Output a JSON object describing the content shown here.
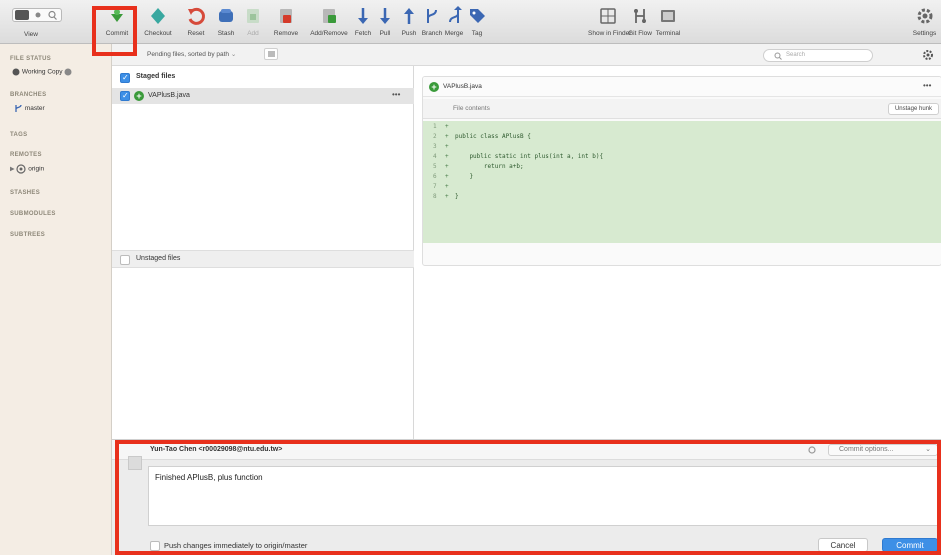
{
  "toolbar": {
    "view_label": "View",
    "buttons": [
      {
        "label": "Commit",
        "icon": "commit-icon"
      },
      {
        "label": "Checkout",
        "icon": "checkout-icon"
      },
      {
        "label": "Reset",
        "icon": "reset-icon"
      },
      {
        "label": "Stash",
        "icon": "stash-icon"
      },
      {
        "label": "Add",
        "icon": "add-icon"
      },
      {
        "label": "Remove",
        "icon": "remove-icon"
      },
      {
        "label": "Add/Remove",
        "icon": "add-remove-icon"
      },
      {
        "label": "Fetch",
        "icon": "fetch-icon"
      },
      {
        "label": "Pull",
        "icon": "pull-icon"
      },
      {
        "label": "Push",
        "icon": "push-icon"
      },
      {
        "label": "Branch",
        "icon": "branch-icon"
      },
      {
        "label": "Merge",
        "icon": "merge-icon"
      },
      {
        "label": "Tag",
        "icon": "tag-icon"
      },
      {
        "label": "Show in Finder",
        "icon": "finder-icon"
      },
      {
        "label": "Git Flow",
        "icon": "git-flow-icon"
      },
      {
        "label": "Terminal",
        "icon": "terminal-icon"
      },
      {
        "label": "Settings",
        "icon": "gear-icon"
      }
    ]
  },
  "sidebar": {
    "file_status_header": "FILE STATUS",
    "working_copy": "Working Copy",
    "branches_header": "BRANCHES",
    "branch_master": "master",
    "tags_header": "TAGS",
    "remotes_header": "REMOTES",
    "remote_origin": "origin",
    "stashes_header": "STASHES",
    "submodules_header": "SUBMODULES",
    "subtrees_header": "SUBTREES"
  },
  "files": {
    "sort_label": "Pending files, sorted by path",
    "staged_header": "Staged files",
    "staged_files": [
      {
        "name": "VAPlusB.java"
      }
    ],
    "unstaged_header": "Unstaged files",
    "row_menu": "•••"
  },
  "diff": {
    "search_placeholder": "Search",
    "file_name": "VAPlusB.java",
    "file_menu": "•••",
    "hunk_title": "File contents",
    "unstage_hunk_label": "Unstage hunk",
    "lines": [
      {
        "num": "1",
        "sign": "+",
        "text": ""
      },
      {
        "num": "2",
        "sign": "+",
        "text": "public class APlusB {"
      },
      {
        "num": "3",
        "sign": "+",
        "text": ""
      },
      {
        "num": "4",
        "sign": "+",
        "text": "    public static int plus(int a, int b){"
      },
      {
        "num": "5",
        "sign": "+",
        "text": "        return a+b;"
      },
      {
        "num": "6",
        "sign": "+",
        "text": "    }"
      },
      {
        "num": "7",
        "sign": "+",
        "text": ""
      },
      {
        "num": "8",
        "sign": "+",
        "text": "}"
      }
    ]
  },
  "commit": {
    "author": "Yun-Tao Chen <r00029098@ntu.edu.tw>",
    "message": "Finished APlusB, plus function",
    "options_label": "Commit options...",
    "push_label": "Push changes immediately to origin/master",
    "cancel_label": "Cancel",
    "commit_label": "Commit"
  },
  "colors": {
    "highlight": "#e8301c",
    "sidebar_bg": "#f4ede4",
    "diff_added_bg": "#d7ead0",
    "accent_blue": "#3d8fe6"
  }
}
